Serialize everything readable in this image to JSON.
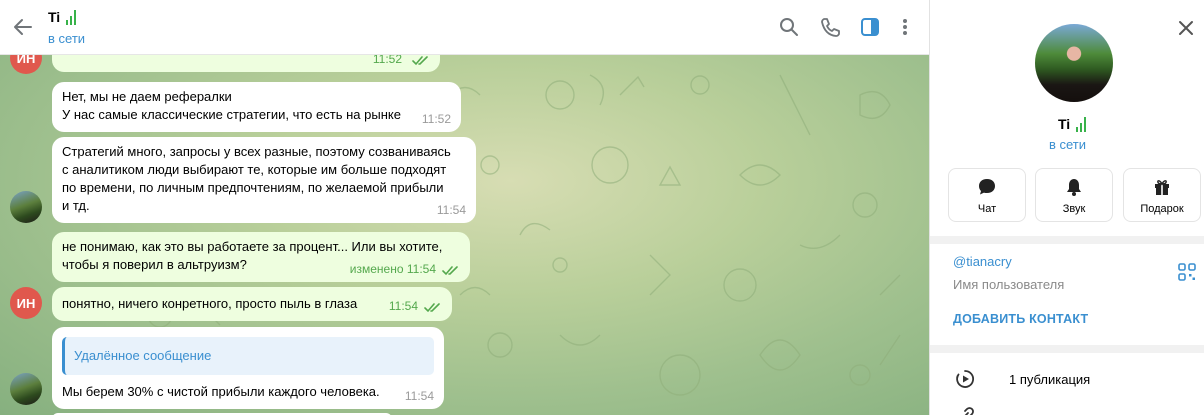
{
  "chat": {
    "title": "Ti",
    "status": "в сети",
    "header_icons": [
      "back-arrow-icon",
      "search-icon",
      "phone-icon",
      "sidebar-toggle-icon",
      "more-vertical-icon"
    ],
    "messages": [
      {
        "id": "m0",
        "direction": "out",
        "text": "",
        "time": "11:52",
        "read": true
      },
      {
        "id": "m1",
        "direction": "in",
        "lines": [
          "Нет, мы не даем рефералки",
          "У нас самые классические стратегии, что есть на рынке"
        ],
        "time": "11:52"
      },
      {
        "id": "m2",
        "direction": "in",
        "lines": [
          "Стратегий много, запросы у всех разные, поэтому созваниваясь",
          "с аналитиком люди выбирают те, которые им больше подходят",
          "по времени, по личным предпочтениям, по желаемой прибыли",
          "и тд."
        ],
        "time": "11:54"
      },
      {
        "id": "m3",
        "direction": "out",
        "lines": [
          "не понимаю, как это вы работаете за процент...  Или вы хотите,",
          "чтобы я поверил в альтруизм?"
        ],
        "time": "изменено 11:54",
        "read": true
      },
      {
        "id": "m4",
        "direction": "out",
        "lines": [
          "понятно, ничего конретного, просто пыль в глаза"
        ],
        "time": "11:54",
        "read": true
      },
      {
        "id": "m5",
        "direction": "in",
        "quote": "Удалённое сообщение",
        "lines": [
          "Мы берем 30% с чистой прибыли каждого человека."
        ],
        "time": "11:54"
      }
    ],
    "avatar_initials": "ИН"
  },
  "panel": {
    "name": "Ti",
    "status": "в сети",
    "actions": [
      {
        "label": "Чат",
        "icon": "chat-bubble-icon"
      },
      {
        "label": "Звук",
        "icon": "bell-icon"
      },
      {
        "label": "Подарок",
        "icon": "gift-icon"
      }
    ],
    "username": "@tianacry",
    "username_label": "Имя пользователя",
    "add_contact": "ДОБАВИТЬ КОНТАКТ",
    "publications": "1 публикация"
  },
  "colors": {
    "accent": "#3a8fd0",
    "outgoing_bubble": "#eefedf",
    "read_ticks": "#54a84d",
    "initials_avatar": "#e0584d",
    "green_bars": "#38b24a"
  }
}
